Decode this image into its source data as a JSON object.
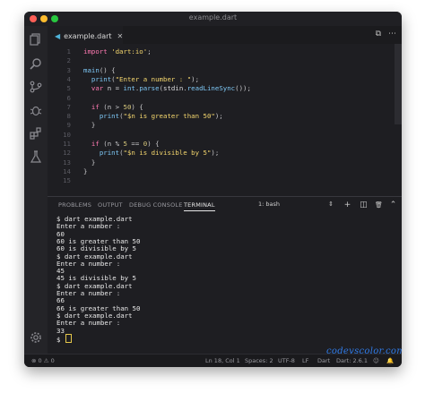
{
  "window": {
    "title": "example.dart"
  },
  "tab": {
    "icon": "dart-icon",
    "glyph": "◀",
    "label": "example.dart",
    "close": "✕"
  },
  "tab_actions": [
    "⧉",
    "⋯"
  ],
  "editor": {
    "lines": [
      {
        "n": "1",
        "parts": [
          [
            "kw",
            "import "
          ],
          [
            "str",
            "'dart:io'"
          ],
          [
            "punc",
            ";"
          ]
        ]
      },
      {
        "n": "2",
        "parts": []
      },
      {
        "n": "3",
        "parts": [
          [
            "fn",
            "main"
          ],
          [
            "punc",
            "() {"
          ]
        ]
      },
      {
        "n": "4",
        "parts": [
          [
            "id",
            "  "
          ],
          [
            "fn",
            "print"
          ],
          [
            "punc",
            "("
          ],
          [
            "str",
            "\"Enter a number : \""
          ],
          [
            "punc",
            ");"
          ]
        ]
      },
      {
        "n": "5",
        "parts": [
          [
            "id",
            "  "
          ],
          [
            "kw",
            "var"
          ],
          [
            "id",
            " n = "
          ],
          [
            "fn",
            "int"
          ],
          [
            "punc",
            "."
          ],
          [
            "fn",
            "parse"
          ],
          [
            "punc",
            "("
          ],
          [
            "id",
            "stdin"
          ],
          [
            "punc",
            "."
          ],
          [
            "fn",
            "readLineSync"
          ],
          [
            "punc",
            "());"
          ]
        ]
      },
      {
        "n": "6",
        "parts": []
      },
      {
        "n": "7",
        "parts": [
          [
            "id",
            "  "
          ],
          [
            "kw",
            "if"
          ],
          [
            "punc",
            " (n > "
          ],
          [
            "num",
            "50"
          ],
          [
            "punc",
            ") {"
          ]
        ]
      },
      {
        "n": "8",
        "parts": [
          [
            "id",
            "    "
          ],
          [
            "fn",
            "print"
          ],
          [
            "punc",
            "("
          ],
          [
            "str",
            "\"$n is greater than 50\""
          ],
          [
            "punc",
            ");"
          ]
        ]
      },
      {
        "n": "9",
        "parts": [
          [
            "punc",
            "  }"
          ]
        ]
      },
      {
        "n": "10",
        "parts": []
      },
      {
        "n": "11",
        "parts": [
          [
            "id",
            "  "
          ],
          [
            "kw",
            "if"
          ],
          [
            "punc",
            " (n % "
          ],
          [
            "num",
            "5"
          ],
          [
            "punc",
            " == "
          ],
          [
            "num",
            "0"
          ],
          [
            "punc",
            ") {"
          ]
        ]
      },
      {
        "n": "12",
        "parts": [
          [
            "id",
            "    "
          ],
          [
            "fn",
            "print"
          ],
          [
            "punc",
            "("
          ],
          [
            "str",
            "\"$n is divisible by 5\""
          ],
          [
            "punc",
            ");"
          ]
        ]
      },
      {
        "n": "13",
        "parts": [
          [
            "punc",
            "  }"
          ]
        ]
      },
      {
        "n": "14",
        "parts": [
          [
            "punc",
            "}"
          ]
        ]
      },
      {
        "n": "15",
        "parts": []
      }
    ]
  },
  "panel": {
    "tabs": [
      {
        "label": "PROBLEMS",
        "active": false
      },
      {
        "label": "OUTPUT",
        "active": false
      },
      {
        "label": "DEBUG CONSOLE",
        "active": false
      },
      {
        "label": "TERMINAL",
        "active": true
      }
    ],
    "terminal_select": "1: bash",
    "terminal_select_arrow": "⇕",
    "actions": [
      "+",
      "◫",
      "🗑",
      "⌃",
      "✕"
    ]
  },
  "terminal": {
    "lines": [
      "$ dart example.dart",
      "Enter a number :",
      "60",
      "60 is greater than 50",
      "60 is divisible by 5",
      "$ dart example.dart",
      "Enter a number :",
      "45",
      "45 is divisible by 5",
      "$ dart example.dart",
      "Enter a number :",
      "66",
      "66 is greater than 50",
      "$ dart example.dart",
      "Enter a number :",
      "33"
    ],
    "prompt": "$ "
  },
  "watermark": "codevscolor.com",
  "statusbar": {
    "problems": "⊗ 0  ⚠ 0",
    "position": "Ln 18, Col 1",
    "spaces": "Spaces: 2",
    "encoding": "UTF-8",
    "eol": "LF",
    "language": "Dart",
    "version": "Dart: 2.6.1",
    "feedback": "☺",
    "bell": "🔔"
  }
}
